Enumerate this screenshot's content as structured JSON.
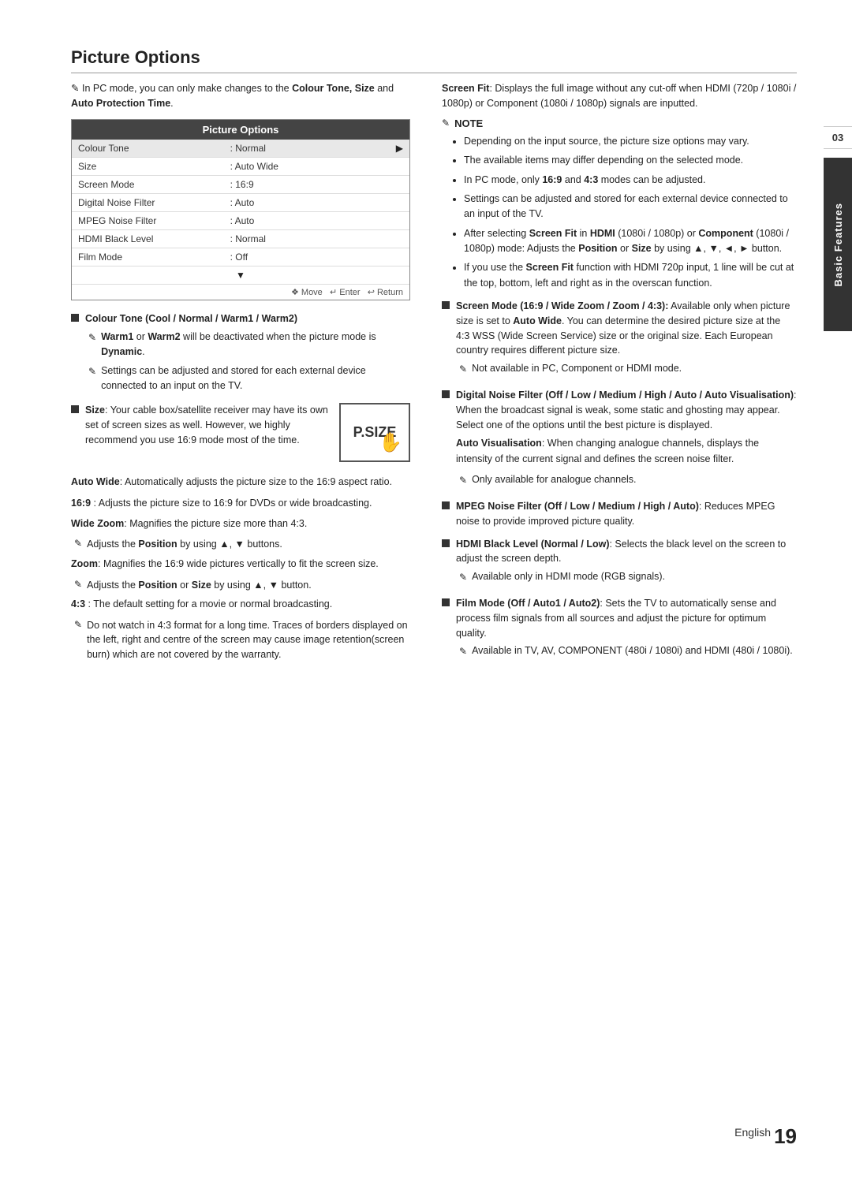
{
  "page": {
    "title": "Picture Options",
    "chapter": "03",
    "chapter_label": "Basic Features",
    "footer_text": "English",
    "footer_number": "19"
  },
  "intro": {
    "pencil": "✎",
    "text_pre": "In PC mode, you can only make changes to the ",
    "bold_text": "Colour Tone, Size",
    "text_post": " and ",
    "bold_text2": "Auto Protection Time",
    "text_end": "."
  },
  "table": {
    "header": "Picture Options",
    "rows": [
      {
        "label": "Colour Tone",
        "value": "Normal",
        "selected": true,
        "arrow": "▶"
      },
      {
        "label": "Size",
        "value": "Auto Wide",
        "selected": false,
        "arrow": ""
      },
      {
        "label": "Screen Mode",
        "value": "16:9",
        "selected": false,
        "arrow": ""
      },
      {
        "label": "Digital Noise Filter",
        "value": "Auto",
        "selected": false,
        "arrow": ""
      },
      {
        "label": "MPEG Noise Filter",
        "value": "Auto",
        "selected": false,
        "arrow": ""
      },
      {
        "label": "HDMI Black Level",
        "value": "Normal",
        "selected": false,
        "arrow": ""
      },
      {
        "label": "Film Mode",
        "value": "Off",
        "selected": false,
        "arrow": ""
      }
    ],
    "nav_text": "❖ Move  ↵ Enter  ↩ Return"
  },
  "left_bullets": [
    {
      "id": "colour-tone",
      "title": "Colour Tone (Cool / Normal / Warm1 / Warm2)",
      "subs": [
        {
          "pencil": "✎",
          "text_pre": "",
          "bold": "Warm1",
          "text_mid": " or ",
          "bold2": "Warm2",
          "text_post": " will be deactivated when the picture mode is ",
          "bold3": "Dynamic",
          "text_end": "."
        },
        {
          "pencil": "✎",
          "text": "Settings can be adjusted and stored for each external device connected to an input on the TV."
        }
      ]
    },
    {
      "id": "size",
      "title": "Size",
      "title_pre": "",
      "text": ": Your cable box/satellite receiver may have its own set of screen sizes as well. However, we highly recommend you use 16:9 mode most of the time.",
      "has_psize": true
    }
  ],
  "left_paras": [
    {
      "id": "auto-wide",
      "bold": "Auto Wide",
      "text": ": Automatically adjusts the picture size to the 16:9 aspect ratio."
    },
    {
      "id": "16-9",
      "bold": "16:9",
      "text": " : Adjusts the picture size to 16:9 for DVDs or wide broadcasting."
    },
    {
      "id": "wide-zoom",
      "bold": "Wide Zoom",
      "text": ": Magnifies the picture size more than 4:3.",
      "sub": {
        "pencil": "✎",
        "text": "Adjusts the ",
        "bold": "Position",
        "text2": " by using ",
        "arrows": "▲, ▼",
        "text3": " buttons."
      }
    },
    {
      "id": "zoom",
      "bold": "Zoom",
      "text": ": Magnifies the 16:9 wide pictures vertically to fit the screen size.",
      "sub": {
        "pencil": "✎",
        "text": "Adjusts the ",
        "bold": "Position",
        "text2": " or ",
        "bold2": "Size",
        "text3": " by using ",
        "arrows": "▲, ▼",
        "text4": " button."
      }
    },
    {
      "id": "4-3",
      "bold": "4:3",
      "text": " : The default setting for a movie or normal broadcasting.",
      "sub": {
        "pencil": "✎",
        "text": "Do not watch in 4:3 format for a long time. Traces of borders displayed on the left, right and centre of the screen may cause image retention(screen burn) which are not covered by the warranty."
      }
    }
  ],
  "right_section": {
    "screen_fit_para": {
      "bold": "Screen Fit",
      "text": ": Displays the full image without any cut-off when HDMI (720p / 1080i / 1080p) or Component (1080i / 1080p) signals are inputted."
    },
    "note": {
      "pencil": "✎",
      "title": "NOTE",
      "items": [
        "Depending on the input source, the picture size options may vary.",
        "The available items may differ depending on the selected mode.",
        "In PC mode, only 16:9 and 4:3 modes can be adjusted.",
        "Settings can be adjusted and stored for each external device connected to an input of the TV.",
        "After selecting Screen Fit in HDMI (1080i / 1080p) or Component (1080i / 1080p) mode: Adjusts the Position or Size by using ▲, ▼, ◄, ► button.",
        "If you use the Screen Fit function with HDMI 720p input, 1 line will be cut at the top, bottom, left and right as in the overscan function."
      ]
    }
  },
  "right_bullets": [
    {
      "id": "screen-mode",
      "title": "Screen Mode (16:9 / Wide Zoom / Zoom / 4:3):",
      "text": "Available only when picture size is set to Auto Wide. You can determine the desired picture size at the 4:3 WSS (Wide Screen Service) size or the original size. Each European country requires different picture size.",
      "sub": {
        "pencil": "✎",
        "text": "Not available in PC, Component or HDMI mode."
      }
    },
    {
      "id": "digital-noise",
      "title": "Digital Noise Filter (Off / Low / Medium / High / Auto Visualisation)",
      "text": ": When the broadcast signal is weak, some static and ghosting may appear. Select one of the options until the best picture is displayed.",
      "sub_para": {
        "bold": "Auto Visualisation",
        "text": ": When changing analogue channels, displays the intensity of the current signal and defines the screen noise filter."
      },
      "sub2": {
        "pencil": "✎",
        "text": "Only available for analogue channels."
      }
    },
    {
      "id": "mpeg-noise",
      "title": "MPEG Noise Filter (Off / Low / Medium / High / Auto)",
      "text": ": Reduces MPEG noise to provide improved picture quality."
    },
    {
      "id": "hdmi-black",
      "title": "HDMI Black Level (Normal / Low)",
      "text": ": Selects the black level on the screen to adjust the screen depth.",
      "sub": {
        "pencil": "✎",
        "text": "Available only in HDMI mode (RGB signals)."
      }
    },
    {
      "id": "film-mode",
      "title": "Film Mode (Off / Auto1 / Auto2)",
      "text": ": Sets the TV to automatically sense and process film signals from all sources and adjust the picture for optimum quality.",
      "sub": {
        "pencil": "✎",
        "text": "Available in TV, AV, COMPONENT (480i / 1080i) and HDMI (480i / 1080i)."
      }
    }
  ]
}
